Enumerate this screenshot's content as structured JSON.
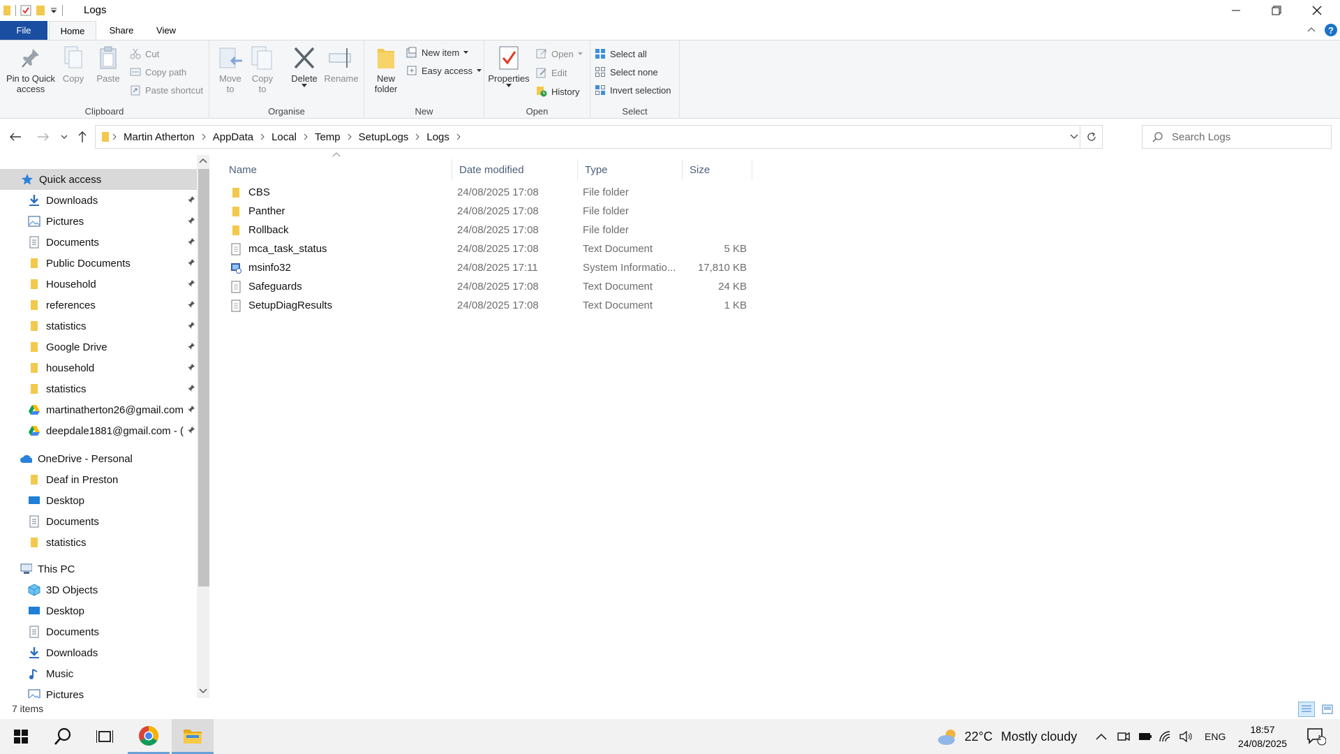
{
  "window": {
    "title": "Logs"
  },
  "tabs": {
    "file": "File",
    "home": "Home",
    "share": "Share",
    "view": "View"
  },
  "ribbon": {
    "clipboard": {
      "label": "Clipboard",
      "pin_line1": "Pin to Quick",
      "pin_line2": "access",
      "copy": "Copy",
      "paste": "Paste",
      "cut": "Cut",
      "copy_path": "Copy path",
      "paste_shortcut": "Paste shortcut"
    },
    "organise": {
      "label": "Organise",
      "move_line1": "Move",
      "move_line2": "to",
      "copy_line1": "Copy",
      "copy_line2": "to",
      "delete": "Delete",
      "rename": "Rename"
    },
    "new": {
      "label": "New",
      "folder_line1": "New",
      "folder_line2": "folder",
      "new_item": "New item",
      "easy_access": "Easy access"
    },
    "open": {
      "label": "Open",
      "properties": "Properties",
      "open": "Open",
      "edit": "Edit",
      "history": "History"
    },
    "select": {
      "label": "Select",
      "select_all": "Select all",
      "select_none": "Select none",
      "invert": "Invert selection"
    }
  },
  "breadcrumb": [
    "Martin Atherton",
    "AppData",
    "Local",
    "Temp",
    "SetupLogs",
    "Logs"
  ],
  "search": {
    "placeholder": "Search Logs"
  },
  "nav": {
    "quick_access": "Quick access",
    "quick_items": [
      {
        "label": "Downloads",
        "icon": "download-icon"
      },
      {
        "label": "Pictures",
        "icon": "pictures-icon"
      },
      {
        "label": "Documents",
        "icon": "documents-icon"
      },
      {
        "label": "Public Documents",
        "icon": "folder-icon"
      },
      {
        "label": "Household",
        "icon": "folder-icon"
      },
      {
        "label": "references",
        "icon": "folder-icon"
      },
      {
        "label": "statistics",
        "icon": "folder-icon"
      },
      {
        "label": "Google Drive",
        "icon": "folder-icon"
      },
      {
        "label": "household",
        "icon": "folder-icon"
      },
      {
        "label": "statistics",
        "icon": "folder-icon"
      },
      {
        "label": "martinatherton26@gmail.com",
        "icon": "google-drive-icon"
      },
      {
        "label": "deepdale1881@gmail.com - (",
        "icon": "google-drive-icon"
      }
    ],
    "onedrive": "OneDrive - Personal",
    "onedrive_items": [
      {
        "label": "Deaf in Preston",
        "icon": "folder-icon"
      },
      {
        "label": "Desktop",
        "icon": "desktop-icon"
      },
      {
        "label": "Documents",
        "icon": "documents-icon"
      },
      {
        "label": "statistics",
        "icon": "folder-icon"
      }
    ],
    "this_pc": "This PC",
    "pc_items": [
      {
        "label": "3D Objects",
        "icon": "3d-objects-icon"
      },
      {
        "label": "Desktop",
        "icon": "desktop-icon"
      },
      {
        "label": "Documents",
        "icon": "documents-icon"
      },
      {
        "label": "Downloads",
        "icon": "download-icon"
      },
      {
        "label": "Music",
        "icon": "music-icon"
      },
      {
        "label": "Pictures",
        "icon": "pictures-icon"
      }
    ]
  },
  "columns": {
    "name": "Name",
    "date": "Date modified",
    "type": "Type",
    "size": "Size"
  },
  "files": [
    {
      "name": "CBS",
      "date": "24/08/2025 17:08",
      "type": "File folder",
      "size": "",
      "icon": "folder-icon"
    },
    {
      "name": "Panther",
      "date": "24/08/2025 17:08",
      "type": "File folder",
      "size": "",
      "icon": "folder-icon"
    },
    {
      "name": "Rollback",
      "date": "24/08/2025 17:08",
      "type": "File folder",
      "size": "",
      "icon": "folder-icon"
    },
    {
      "name": "mca_task_status",
      "date": "24/08/2025 17:08",
      "type": "Text Document",
      "size": "5 KB",
      "icon": "text-file-icon"
    },
    {
      "name": "msinfo32",
      "date": "24/08/2025 17:11",
      "type": "System Informatio...",
      "size": "17,810 KB",
      "icon": "system-info-icon"
    },
    {
      "name": "Safeguards",
      "date": "24/08/2025 17:08",
      "type": "Text Document",
      "size": "24 KB",
      "icon": "text-file-icon"
    },
    {
      "name": "SetupDiagResults",
      "date": "24/08/2025 17:08",
      "type": "Text Document",
      "size": "1 KB",
      "icon": "text-file-icon"
    }
  ],
  "status": {
    "count": "7 items"
  },
  "taskbar": {
    "weather_temp": "22°C",
    "weather_desc": "Mostly cloudy",
    "language": "ENG",
    "time": "18:57",
    "date": "24/08/2025",
    "notification_count": "1"
  },
  "colors": {
    "accent": "#1a4ea0",
    "folder": "#f2c94c",
    "selection": "#d9d9d9",
    "header_text": "#4c607a"
  }
}
